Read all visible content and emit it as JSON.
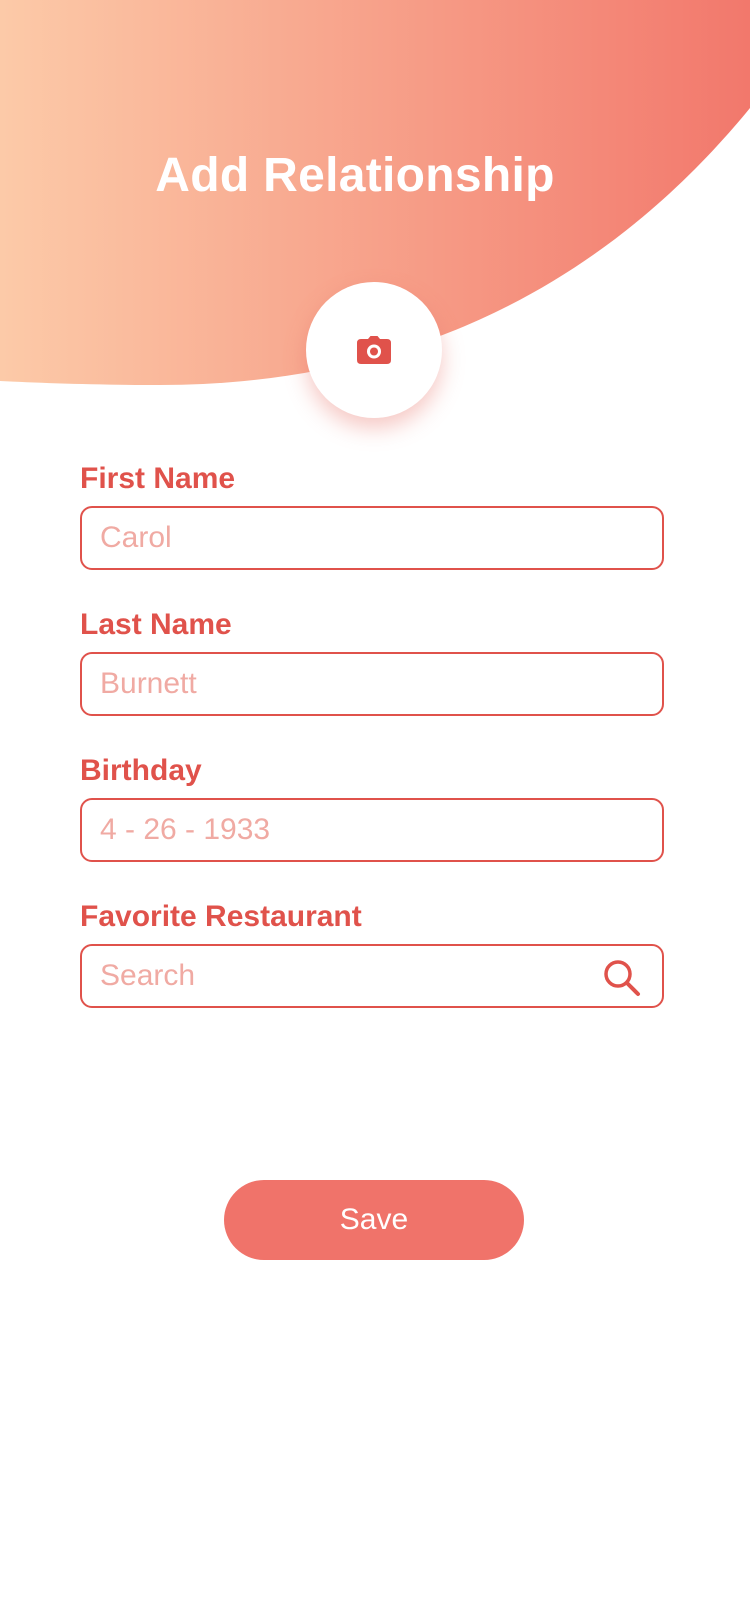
{
  "header": {
    "title": "Add Relationship",
    "gradient_start": "#fccaa8",
    "gradient_end": "#f2786c"
  },
  "photo": {
    "icon": "camera-icon"
  },
  "form": {
    "first_name": {
      "label": "First Name",
      "placeholder": "Carol"
    },
    "last_name": {
      "label": "Last Name",
      "placeholder": "Burnett"
    },
    "birthday": {
      "label": "Birthday",
      "placeholder": "4 - 26 - 1933"
    },
    "favorite_restaurant": {
      "label": "Favorite Restaurant",
      "placeholder": "Search",
      "icon": "search-icon"
    }
  },
  "actions": {
    "save_label": "Save"
  },
  "colors": {
    "accent": "#e0524b",
    "button": "#f0736a",
    "placeholder": "#f0aaa3"
  }
}
